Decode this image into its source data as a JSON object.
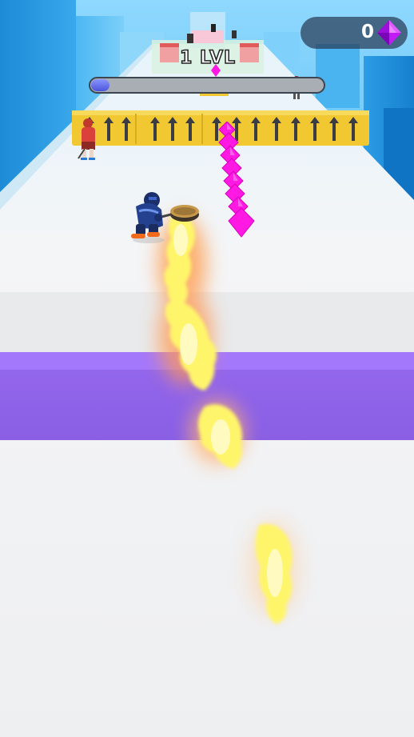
{
  "hud": {
    "gem_count": "0",
    "gem_icon": "purple-gem-icon",
    "level_label": "1 LVL",
    "level_progress": 0.08
  },
  "colors": {
    "track": "#f1f2f4",
    "finish_band": "#8f66e8",
    "barrier": "#f2c832",
    "arrow": "#3a3d44",
    "gem": "#ff19e3",
    "progress_fill": "#5a63e6",
    "fire": "#fff27a"
  },
  "scene": {
    "player": "hockey-player-blue",
    "opponent": "hockey-player-red",
    "puck": "hockey-puck",
    "barrier_arrow_icon": "up-arrow-icon"
  }
}
